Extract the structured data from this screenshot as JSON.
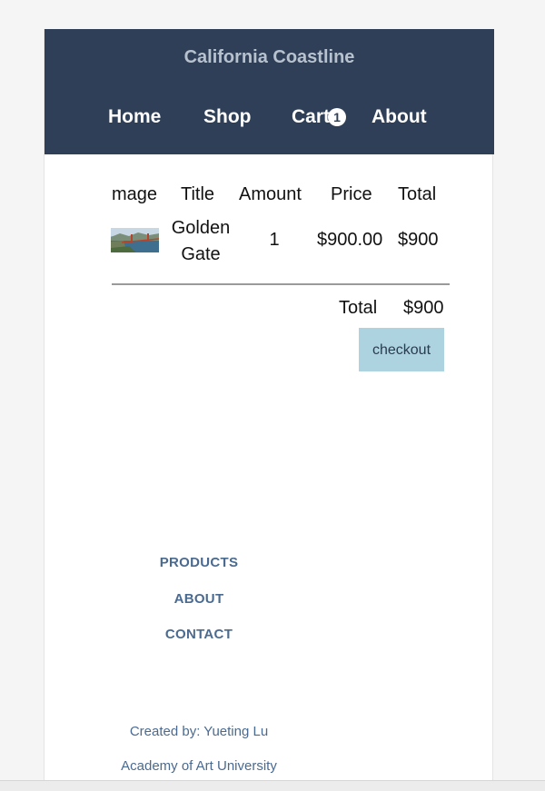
{
  "header": {
    "brand": "California Coastline",
    "nav": {
      "home": "Home",
      "shop": "Shop",
      "cart": "Cart",
      "cart_count": "1",
      "about": "About"
    }
  },
  "cart_table": {
    "headers": {
      "image": "mage",
      "title": "Title",
      "amount": "Amount",
      "price": "Price",
      "total": "Total"
    },
    "rows": [
      {
        "image_icon": "golden-gate-thumbnail",
        "title_line1": "Golden",
        "title_line2": "Gate",
        "amount": "1",
        "price": "$900.00",
        "total": "$900"
      }
    ],
    "summary": {
      "label": "Total",
      "value": "$900"
    },
    "checkout_label": "checkout"
  },
  "footer": {
    "links": {
      "products": "PRODUCTS",
      "about": "ABOUT",
      "contact": "CONTACT"
    },
    "credit_line1": "Created by: Yueting Lu",
    "credit_line2": "Academy of Art University"
  },
  "colors": {
    "header_bg": "#2e3f57",
    "brand_text": "#b8c2cf",
    "checkout_bg": "#add3e0",
    "footer_link": "#4a6a8f"
  }
}
